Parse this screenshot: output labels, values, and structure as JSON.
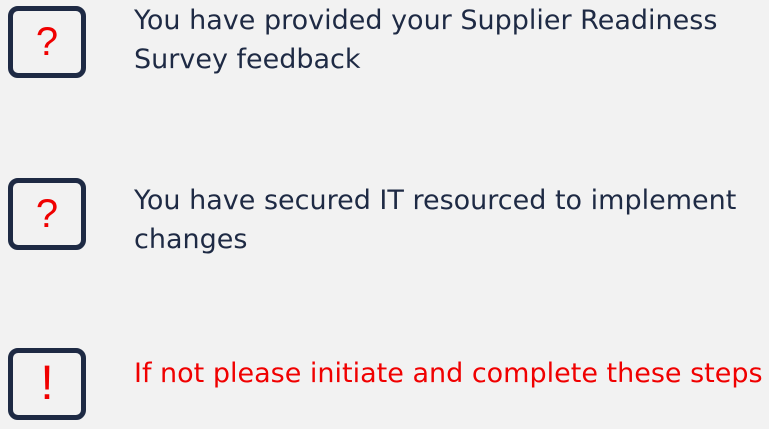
{
  "items": [
    {
      "icon": "question-mark-icon",
      "icon_glyph": "?",
      "text": "You have provided your Supplier Readiness Survey feedback"
    },
    {
      "icon": "question-mark-icon",
      "icon_glyph": "?",
      "text": "You have secured IT resourced to implement changes"
    },
    {
      "icon": "exclamation-mark-icon",
      "icon_glyph": "!",
      "text": "If not please initiate and complete these steps"
    }
  ],
  "colors": {
    "background": "#f2f2f2",
    "box_border": "#1e2a44",
    "text_dark": "#1e2a44",
    "accent_red": "#f00000"
  }
}
